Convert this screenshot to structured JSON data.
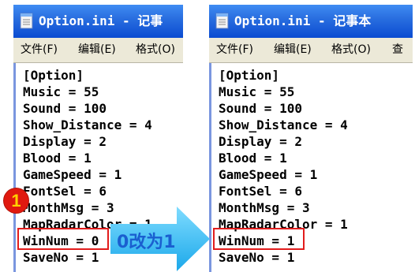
{
  "left_window": {
    "title": "Option.ini - 记事",
    "menu": [
      "文件(F)",
      "编辑(E)",
      "格式(O)"
    ],
    "lines": [
      "[Option]",
      "Music = 55",
      "Sound = 100",
      "Show_Distance = 4",
      "Display = 2",
      "Blood = 1",
      "GameSpeed = 1",
      "FontSel = 6",
      "MonthMsg = 3",
      "MapRadarColor = 1",
      "WinNum = 0",
      "SaveNo = 1"
    ]
  },
  "right_window": {
    "title": "Option.ini - 记事本",
    "menu": [
      "文件(F)",
      "编辑(E)",
      "格式(O)",
      "查"
    ],
    "lines": [
      "[Option]",
      "Music = 55",
      "Sound = 100",
      "Show_Distance = 4",
      "Display = 2",
      "Blood = 1",
      "GameSpeed = 1",
      "FontSel = 6",
      "MonthMsg = 3",
      "MapRadarColor = 1",
      "WinNum = 1",
      "SaveNo = 1"
    ]
  },
  "annotation": {
    "step_number": "1",
    "change_label": "0改为1",
    "highlight_color": "#e21c1c",
    "arrow_color": "#40c4f5"
  },
  "icons": {
    "notepad": "notepad-icon",
    "arrow": "right-arrow-icon"
  }
}
